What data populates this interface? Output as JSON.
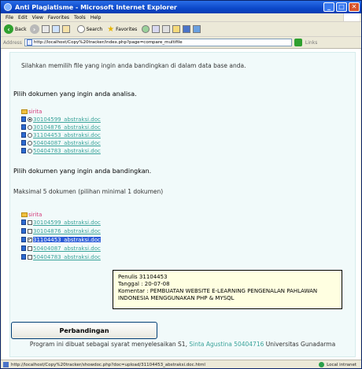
{
  "window": {
    "title": "Anti Plagiatisme - Microsoft Internet Explorer",
    "controls": [
      "minimize",
      "maximize",
      "close"
    ]
  },
  "menu": [
    "File",
    "Edit",
    "View",
    "Favorites",
    "Tools",
    "Help"
  ],
  "toolbar": {
    "back_label": "Back",
    "search_label": "Search",
    "favorites_label": "Favorites"
  },
  "address": {
    "label": "Address",
    "url": "http://localhost/Copy%20tracker/index.php?page=compare_multifile",
    "links_label": "Links"
  },
  "content": {
    "intro": "Silahkan memilih file yang ingin anda bandingkan di dalam data base anda.",
    "analyze_heading": "Pilih dokumen yang ingin anda analisa.",
    "root_label": "sirita",
    "analyze_files": [
      {
        "name": "30104599_abstraksi.doc",
        "selected": true
      },
      {
        "name": "30104876_abstraksi.doc",
        "selected": false
      },
      {
        "name": "31104453_abstraksi.doc",
        "selected": false
      },
      {
        "name": "50404087_abstraksi.doc",
        "selected": false
      },
      {
        "name": "50404783_abstraksi.doc",
        "selected": false
      }
    ],
    "compare_heading": "Pilih dokumen yang ingin anda bandingkan.",
    "compare_note": "Maksimal 5 dokumen (pilihan minimal 1 dokumen)",
    "compare_files": [
      {
        "name": "30104599_abstraksi.doc",
        "checked": false
      },
      {
        "name": "30104876_abstraksi.doc",
        "checked": false
      },
      {
        "name": "31104453_abstraksi.doc",
        "checked": true
      },
      {
        "name": "50404087_abstraksi.doc",
        "checked": false
      },
      {
        "name": "50404783_abstraksi.doc",
        "checked": false
      }
    ],
    "compare_button": "Perbandingan",
    "tooltip": {
      "line1": "Penulis 31104453",
      "line2": "Tanggal : 20-07-08",
      "line3": "Komentar : PEMBUATAN WEBSITE E-LEARNING PENGENALAN PAHLAWAN",
      "line4": "INDONESIA MENGGUNAKAN PHP & MYSQL"
    },
    "footer_prefix": "Program ini dibuat sebagai syarat menyelesaikan S1, ",
    "footer_author": "Sinta Agustina 50404716",
    "footer_suffix": " Universitas Gunadarma"
  },
  "status": {
    "url": "http://localhost/Copy%20tracker/showdoc.php?doc=upload/31104453_abstraksi.doc.html",
    "zone": "Local intranet"
  }
}
